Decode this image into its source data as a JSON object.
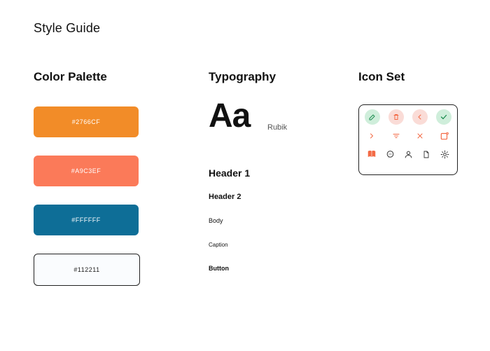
{
  "title": "Style Guide",
  "sections": {
    "color": "Color Palette",
    "typography": "Typography",
    "iconset": "Icon Set"
  },
  "color_palette": [
    {
      "label": "#2766CF",
      "hex": "#F28C28"
    },
    {
      "label": "#A9C3EF",
      "hex": "#FB7A59"
    },
    {
      "label": "#FFFFFF",
      "hex": "#0E6E97"
    },
    {
      "label": "#112211",
      "hex": "#FAFCFE"
    }
  ],
  "typography": {
    "sample": "Aa",
    "family": "Rubik",
    "header1": "Header 1",
    "header2": "Header 2",
    "body": "Body",
    "caption": "Caption",
    "button": "Button"
  },
  "icons": {
    "row1": [
      "edit-icon",
      "trash-icon",
      "chevron-left-icon",
      "check-icon"
    ],
    "row2": [
      "chevron-right-icon",
      "filter-icon",
      "close-icon",
      "add-calendar-icon"
    ],
    "row3": [
      "book-icon",
      "chat-icon",
      "user-icon",
      "document-icon",
      "gear-icon"
    ]
  }
}
